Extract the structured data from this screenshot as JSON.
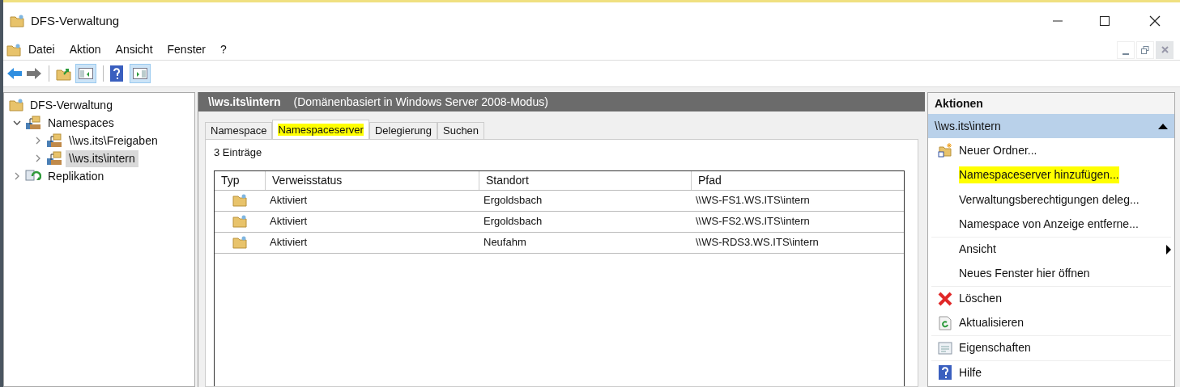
{
  "window": {
    "title": "DFS-Verwaltung"
  },
  "menu": [
    "Datei",
    "Aktion",
    "Ansicht",
    "Fenster",
    "?"
  ],
  "tree": [
    {
      "label": "DFS-Verwaltung",
      "kind": "dfs",
      "selected": false,
      "children": [
        {
          "label": "Namespaces",
          "kind": "namespace",
          "expanded": true,
          "selected": false,
          "children": [
            {
              "label": "\\\\ws.its\\Freigaben",
              "kind": "namespace",
              "expanded": false,
              "selected": false
            },
            {
              "label": "\\\\ws.its\\intern",
              "kind": "namespace",
              "expanded": false,
              "selected": true
            }
          ]
        },
        {
          "label": "Replikation",
          "kind": "replication",
          "expanded": false,
          "selected": false
        }
      ]
    }
  ],
  "header": {
    "title": "\\\\ws.its\\intern",
    "subtitle": "(Domänenbasiert in Windows Server 2008-Modus)"
  },
  "tabs": [
    {
      "label": "Namespace",
      "selected": false,
      "highlighted": false
    },
    {
      "label": "Namespaceserver",
      "selected": true,
      "highlighted": true
    },
    {
      "label": "Delegierung",
      "selected": false,
      "highlighted": false
    },
    {
      "label": "Suchen",
      "selected": false,
      "highlighted": false
    }
  ],
  "count": "3 Einträge",
  "table": {
    "columns": [
      "Typ",
      "Verweisstatus",
      "Standort",
      "Pfad"
    ],
    "rows": [
      {
        "status": "Aktiviert",
        "location": "Ergoldsbach",
        "path": "\\\\WS-FS1.WS.ITS\\intern"
      },
      {
        "status": "Aktiviert",
        "location": "Ergoldsbach",
        "path": "\\\\WS-FS2.WS.ITS\\intern"
      },
      {
        "status": "Aktiviert",
        "location": "Neufahm",
        "path": "\\\\WS-RDS3.WS.ITS\\intern"
      }
    ]
  },
  "actions": {
    "title": "Aktionen",
    "section": "\\\\ws.its\\intern",
    "expanded": true,
    "items": [
      {
        "label": "Neuer Ordner...",
        "kind": "new-folder",
        "highlighted": false
      },
      {
        "label": "Namespaceserver hinzufügen...",
        "kind": "plain",
        "highlighted": true
      },
      {
        "label": "Verwaltungsberechtigungen deleg...",
        "kind": "plain",
        "highlighted": false
      },
      {
        "label": "Namespace von Anzeige entferne...",
        "kind": "plain",
        "highlighted": false
      },
      {
        "label": "Ansicht",
        "kind": "submenu",
        "highlighted": false
      },
      {
        "label": "Neues Fenster hier öffnen",
        "kind": "plain",
        "highlighted": false
      },
      {
        "label": "Löschen",
        "kind": "delete",
        "highlighted": false
      },
      {
        "label": "Aktualisieren",
        "kind": "refresh",
        "highlighted": false
      },
      {
        "label": "Eigenschaften",
        "kind": "properties",
        "highlighted": false
      },
      {
        "label": "Hilfe",
        "kind": "help",
        "highlighted": false
      }
    ]
  }
}
